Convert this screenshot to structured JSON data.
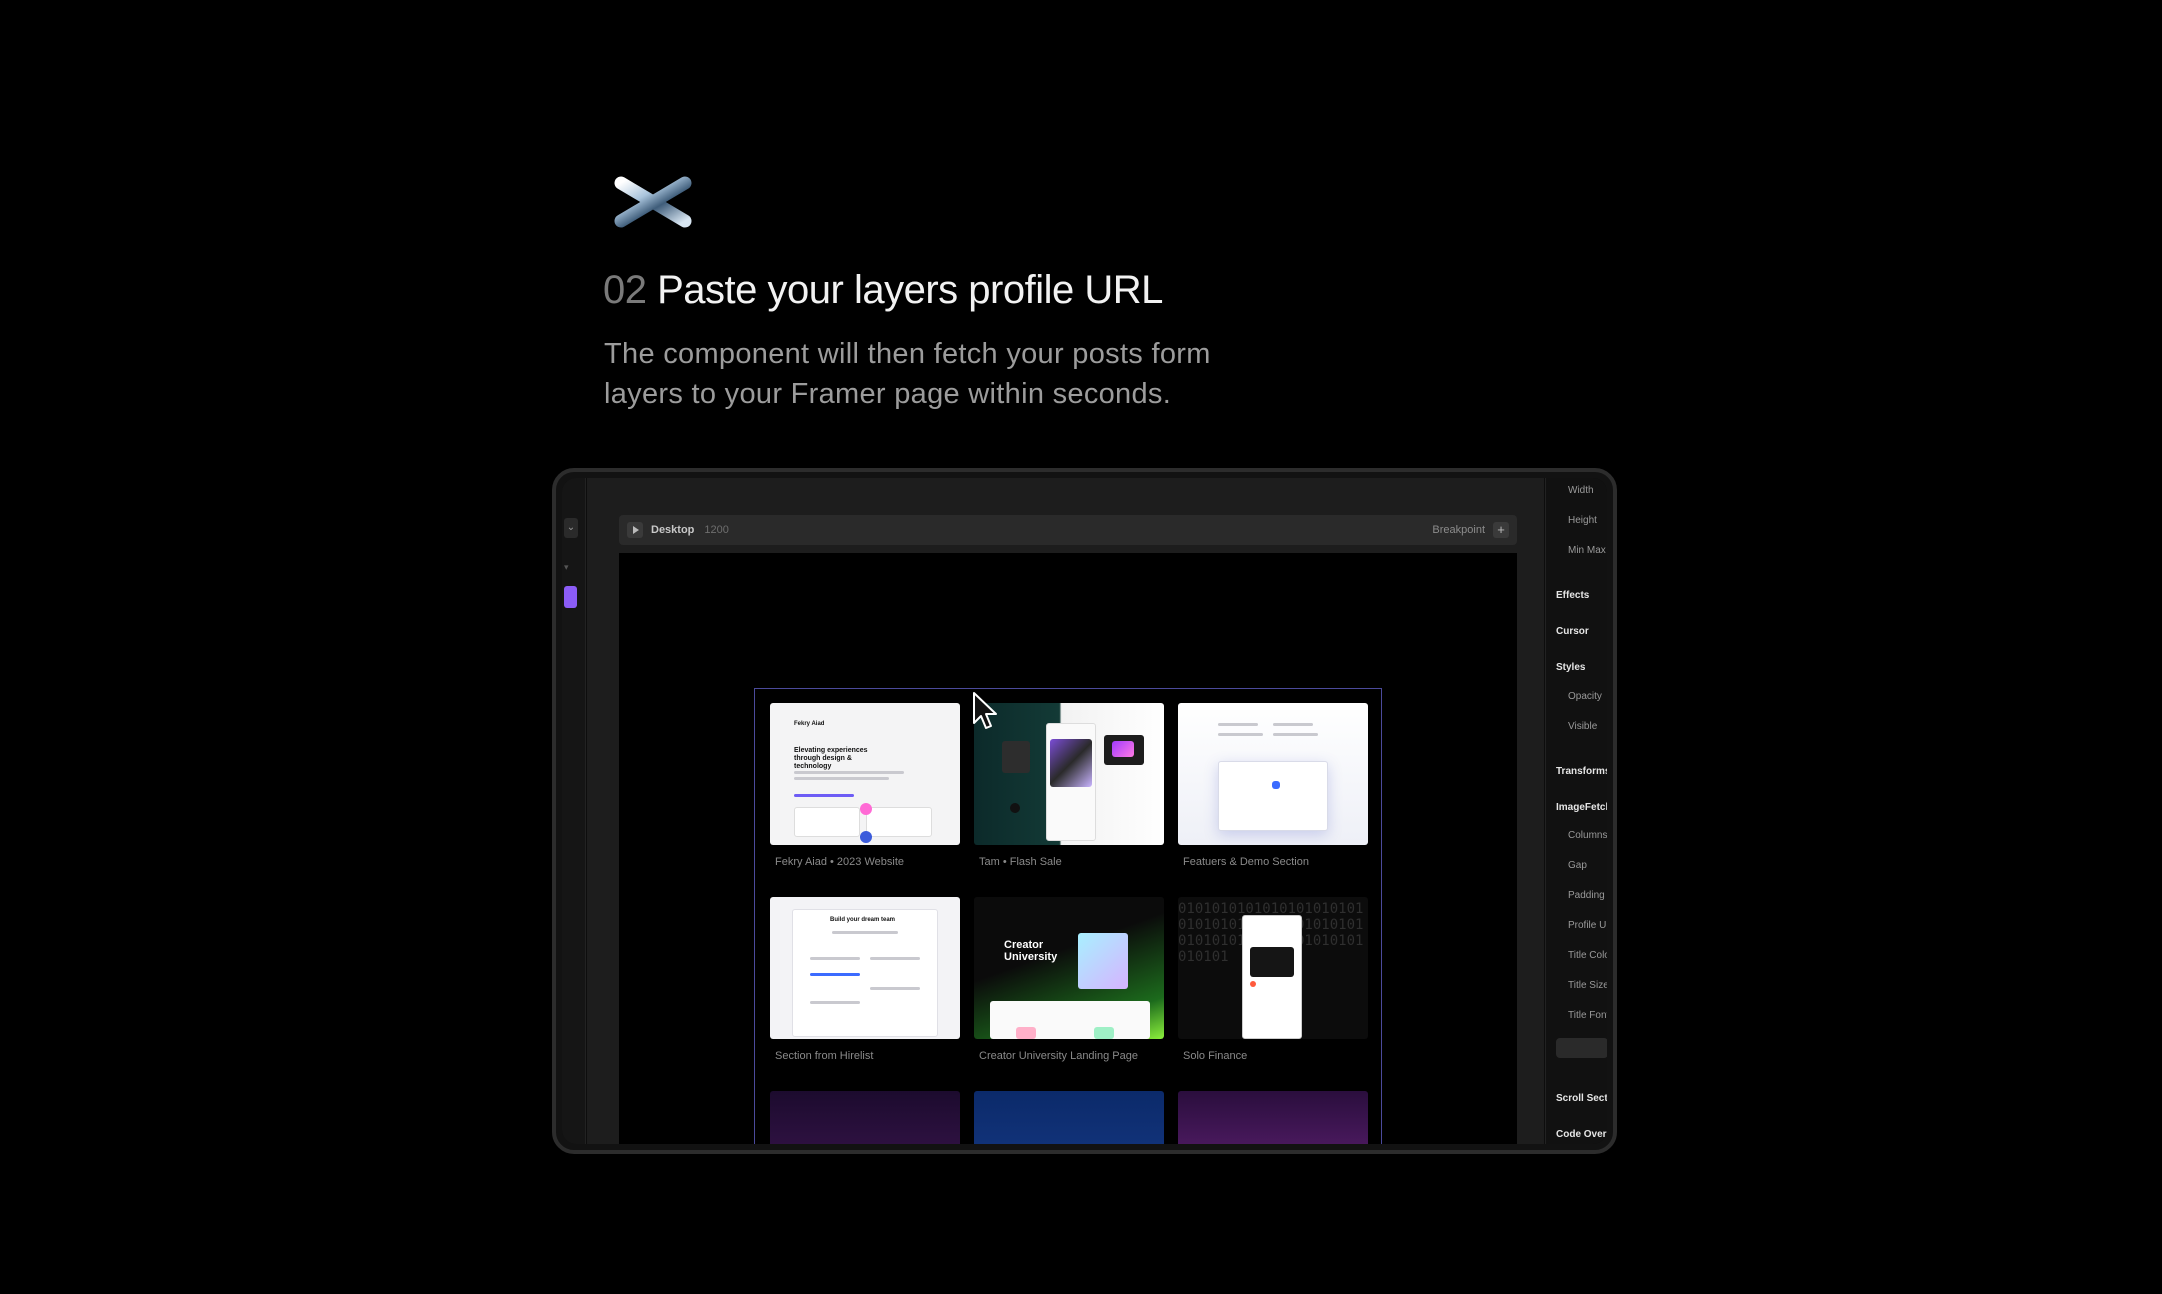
{
  "hero": {
    "logo_icon": "chrome-asterisk-icon",
    "step_number": "02",
    "title": "Paste your layers profile URL",
    "description_line1": "The component will then fetch your posts form",
    "description_line2": "layers to your Framer page within seconds."
  },
  "editor": {
    "breakpoint_bar": {
      "title": "Desktop",
      "width": "1200",
      "breakpoint_label": "Breakpoint",
      "add_icon": "plus-icon"
    },
    "cards": [
      {
        "title": "Fekry Aiad • 2023 Website",
        "thumb_heading": "Elevating experiences through design & technology"
      },
      {
        "title": "Tam • Flash Sale"
      },
      {
        "title": "Featuers & Demo Section"
      },
      {
        "title": "Section from Hirelist",
        "thumb_heading": "Build your dream team"
      },
      {
        "title": "Creator University Landing Page",
        "thumb_heading": "Creator University"
      },
      {
        "title": "Solo Finance"
      },
      {
        "title": ""
      },
      {
        "title": ""
      },
      {
        "title": ""
      }
    ],
    "properties_panel": [
      {
        "label": "Width",
        "kind": "prop"
      },
      {
        "label": "Height",
        "kind": "prop"
      },
      {
        "label": "Min Max",
        "kind": "prop"
      },
      {
        "label": "Effects",
        "kind": "head"
      },
      {
        "label": "Cursor",
        "kind": "head"
      },
      {
        "label": "Styles",
        "kind": "head"
      },
      {
        "label": "Opacity",
        "kind": "prop"
      },
      {
        "label": "Visible",
        "kind": "prop"
      },
      {
        "label": "Transforms",
        "kind": "head"
      },
      {
        "label": "ImageFetch",
        "kind": "head"
      },
      {
        "label": "Columns",
        "kind": "prop"
      },
      {
        "label": "Gap",
        "kind": "prop"
      },
      {
        "label": "Padding",
        "kind": "prop"
      },
      {
        "label": "Profile UF",
        "kind": "prop"
      },
      {
        "label": "Title Colo",
        "kind": "prop"
      },
      {
        "label": "Title Size",
        "kind": "prop"
      },
      {
        "label": "Title Font",
        "kind": "prop"
      },
      {
        "label": "Scroll Sectio",
        "kind": "head"
      },
      {
        "label": "Code Overr",
        "kind": "head"
      }
    ]
  }
}
